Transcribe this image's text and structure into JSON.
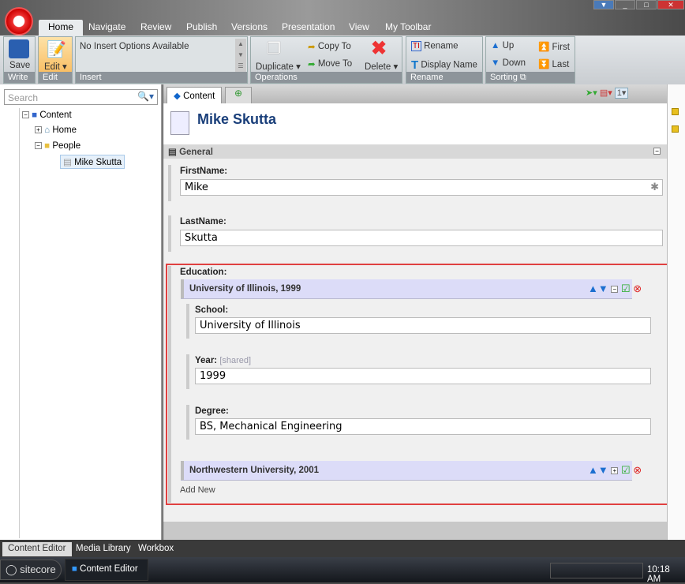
{
  "window": {
    "tabs": [
      "Home",
      "Navigate",
      "Review",
      "Publish",
      "Versions",
      "Presentation",
      "View",
      "My Toolbar"
    ],
    "active_tab": "Home"
  },
  "ribbon": {
    "write": {
      "label": "Write",
      "save": "Save"
    },
    "edit": {
      "label": "Edit",
      "edit": "Edit"
    },
    "insert": {
      "label": "Insert",
      "text": "No Insert Options Available"
    },
    "operations": {
      "label": "Operations",
      "duplicate": "Duplicate",
      "copy_to": "Copy To",
      "move_to": "Move To",
      "delete": "Delete"
    },
    "rename": {
      "label": "Rename",
      "rename": "Rename",
      "display_name": "Display Name"
    },
    "sorting": {
      "label": "Sorting",
      "up": "Up",
      "down": "Down",
      "first": "First",
      "last": "Last"
    }
  },
  "search": {
    "placeholder": "Search"
  },
  "tree": [
    {
      "label": "Content",
      "expander": "−"
    },
    {
      "label": "Home",
      "expander": "+"
    },
    {
      "label": "People",
      "expander": "−"
    },
    {
      "label": "Mike Skutta",
      "selected": true
    }
  ],
  "editor": {
    "tabs": [
      "Content"
    ],
    "version": "1",
    "item_title": "Mike Skutta",
    "section": "General",
    "section_toggle": "−",
    "fields": {
      "firstname_label": "FirstName:",
      "firstname": "Mike",
      "lastname_label": "LastName:",
      "lastname": "Skutta"
    },
    "education": {
      "label": "Education:",
      "entries": [
        {
          "title": "University of Illinois, 1999",
          "toggle": "−",
          "school_label": "School:",
          "school": "University of Illinois",
          "year_label": "Year:",
          "year_shared": "[shared]",
          "year": "1999",
          "degree_label": "Degree:",
          "degree": "BS, Mechanical Engineering"
        },
        {
          "title": "Northwestern University, 2001",
          "toggle": "+"
        }
      ],
      "add_new": "Add New"
    }
  },
  "bottom_tabs": [
    "Content Editor",
    "Media Library",
    "Workbox"
  ],
  "taskbar": {
    "start": "sitecore",
    "app": "Content Editor",
    "clock": "10:18 AM"
  },
  "colors": {
    "highlight": "#e04040",
    "entry_header": "#dcdcf8",
    "accent": "#1a4f8f"
  }
}
